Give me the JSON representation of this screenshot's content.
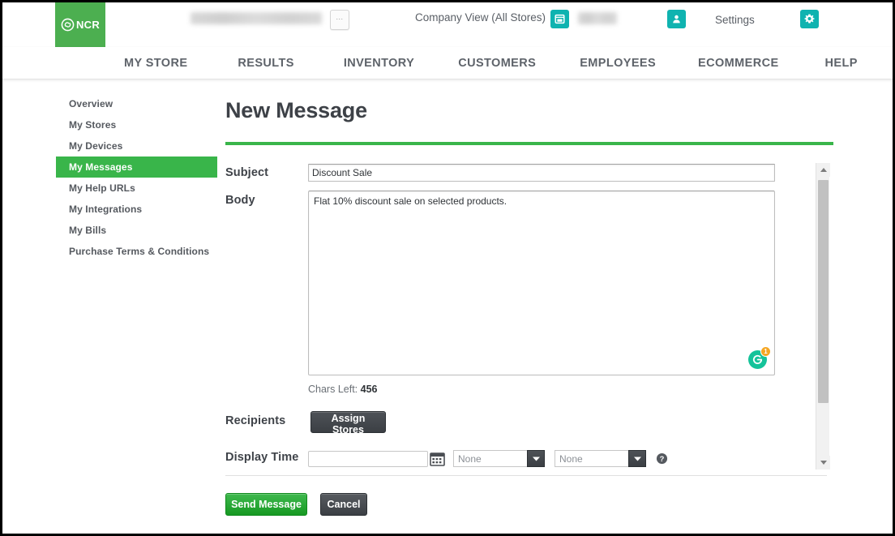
{
  "topbar": {
    "logo_text": "NCR",
    "store_selector_placeholder": "",
    "ellipsis_label": "...",
    "company_view": "Company View (All Stores)",
    "settings_label": "Settings",
    "store_icon": "store-icon",
    "person_icon": "person-icon",
    "gear_icon": "gear-icon"
  },
  "mainnav": {
    "items": [
      {
        "label": "MY STORE"
      },
      {
        "label": "RESULTS"
      },
      {
        "label": "INVENTORY"
      },
      {
        "label": "CUSTOMERS"
      },
      {
        "label": "EMPLOYEES"
      },
      {
        "label": "ECOMMERCE"
      },
      {
        "label": "HELP"
      }
    ]
  },
  "sidebar": {
    "items": [
      {
        "label": "Overview",
        "active": false
      },
      {
        "label": "My Stores",
        "active": false
      },
      {
        "label": "My Devices",
        "active": false
      },
      {
        "label": "My Messages",
        "active": true
      },
      {
        "label": "My Help URLs",
        "active": false
      },
      {
        "label": "My Integrations",
        "active": false
      },
      {
        "label": "My Bills",
        "active": false
      },
      {
        "label": "Purchase Terms & Conditions",
        "active": false
      }
    ]
  },
  "main": {
    "title": "New Message",
    "fields": {
      "subject_label": "Subject",
      "subject_value": "Discount Sale",
      "subject_placeholder": "",
      "body_label": "Body",
      "body_value": "Flat 10% discount sale on selected products.",
      "body_placeholder": "",
      "chars_left_label": "Chars Left:",
      "chars_left_value": "456",
      "recipients_label": "Recipients",
      "assign_stores_label": "Assign Stores",
      "display_time_label": "Display Time",
      "date_value": "",
      "date_placeholder": "",
      "time_hour_value": "None",
      "time_minute_value": "None",
      "help_icon": "help-icon",
      "calendar_icon": "calendar-icon"
    },
    "grammarly": {
      "icon": "grammarly-icon",
      "badge_count": "1"
    },
    "actions": {
      "send_label": "Send Message",
      "cancel_label": "Cancel"
    }
  },
  "colors": {
    "brand_green": "#39b54a",
    "teal_accent": "#0fb3b0",
    "logo_green": "#4caf50",
    "dark_button": "#3b3f44",
    "grammarly_green": "#15c39a",
    "badge_orange": "#f5a623"
  }
}
